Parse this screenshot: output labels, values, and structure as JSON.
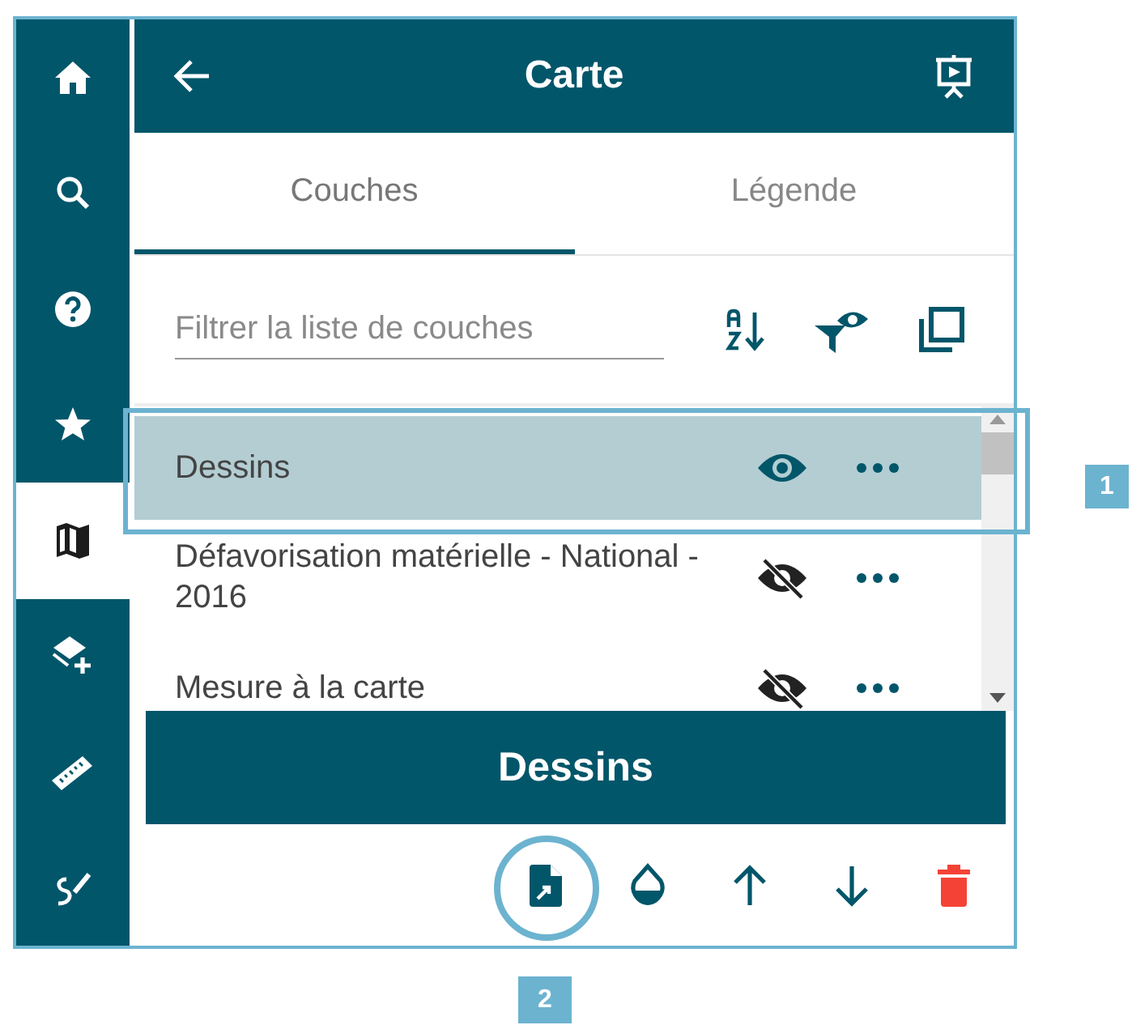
{
  "sidebar": {
    "items": [
      {
        "kind": "home",
        "selected": false
      },
      {
        "kind": "search",
        "selected": false
      },
      {
        "kind": "help",
        "selected": false
      },
      {
        "kind": "star",
        "selected": false
      },
      {
        "kind": "map",
        "selected": true
      },
      {
        "kind": "layer-add",
        "selected": false
      },
      {
        "kind": "ruler",
        "selected": false
      },
      {
        "kind": "draw",
        "selected": false
      }
    ]
  },
  "header": {
    "title": "Carte"
  },
  "tabs": [
    {
      "label": "Couches",
      "selected": true
    },
    {
      "label": "Légende",
      "selected": false
    }
  ],
  "filter": {
    "placeholder": "Filtrer la liste de couches"
  },
  "layers": [
    {
      "name": "Dessins",
      "selected": true,
      "visible": true
    },
    {
      "name": "Défavorisation matérielle - National - 2016",
      "selected": false,
      "visible": false
    },
    {
      "name": "Mesure à la carte",
      "selected": false,
      "visible": false
    }
  ],
  "layer_panel": {
    "title": "Dessins"
  },
  "layer_tools": [
    {
      "kind": "export"
    },
    {
      "kind": "opacity"
    },
    {
      "kind": "up"
    },
    {
      "kind": "down"
    },
    {
      "kind": "delete"
    }
  ],
  "callouts": [
    {
      "label": "1"
    },
    {
      "label": "2"
    }
  ]
}
